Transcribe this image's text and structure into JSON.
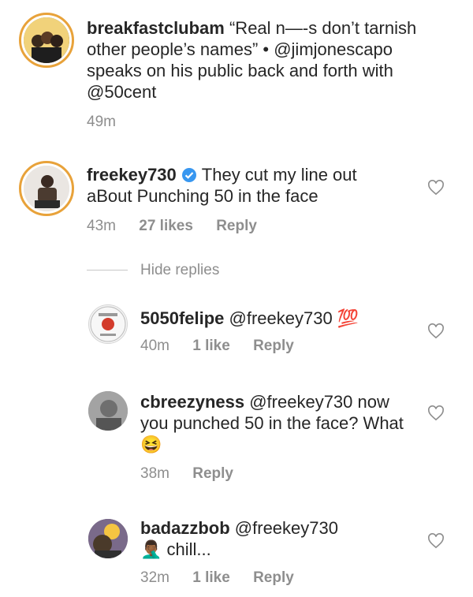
{
  "post": {
    "username": "breakfastclubam",
    "caption": "“Real n—-s don’t tarnish other people’s names” • @jimjonescapo speaks on his public back and forth with @50cent",
    "time": "49m"
  },
  "comments": [
    {
      "username": "freekey730",
      "verified": true,
      "text": "They cut my line out aBout Punching 50 in the face",
      "time": "43m",
      "likes": "27 likes",
      "reply": "Reply"
    }
  ],
  "hide_replies": "Hide replies",
  "replies": [
    {
      "username": "5050felipe",
      "text": "@freekey730",
      "emoji": "💯",
      "time": "40m",
      "likes": "1 like",
      "reply": "Reply"
    },
    {
      "username": "cbreezyness",
      "text": "@freekey730 now you punched 50 in the face? What",
      "emoji": "😆",
      "time": "38m",
      "likes": "",
      "reply": "Reply"
    },
    {
      "username": "badazzbob",
      "text": "@freekey730",
      "line2_emoji": "🤦🏾‍♂️",
      "line2": "chill...",
      "time": "32m",
      "likes": "1 like",
      "reply": "Reply"
    }
  ],
  "colors": {
    "ring": "#e8a23a",
    "verified": "#3897f0",
    "meta": "#8e8e8e"
  }
}
